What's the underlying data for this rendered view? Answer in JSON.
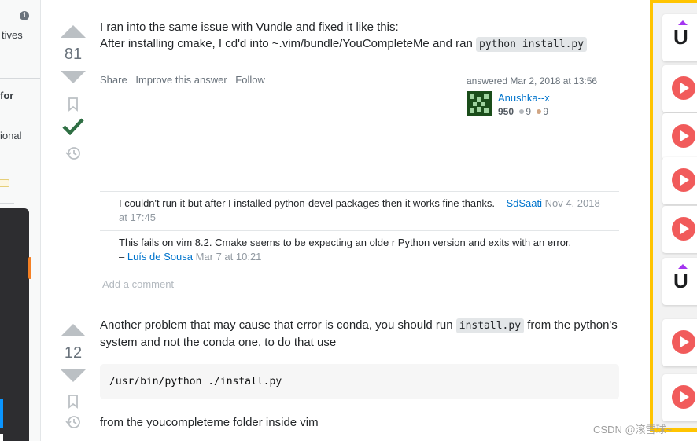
{
  "left_sidebar": {
    "fragments": [
      "tives",
      "for",
      "ional"
    ]
  },
  "answers": [
    {
      "votes": "81",
      "accepted": true,
      "body_line1": "I ran into the same issue with Vundle and fixed it like this:",
      "body_line2_prefix": "After installing cmake, I cd'd into ~.vim/bundle/YouCompleteMe and ran ",
      "body_line2_code": "python install.py",
      "menu": [
        "Share",
        "Improve this answer",
        "Follow"
      ],
      "user": {
        "action_time": "answered Mar 2, 2018 at 13:56",
        "name": "Anushka--x",
        "reputation": "950",
        "silver": "9",
        "bronze": "9"
      },
      "comments": [
        {
          "text": "I couldn't run it but after I installed python-devel packages then it works fine thanks. – ",
          "user": "SdSaati",
          "date": " Nov 4, 2018 at 17:45"
        },
        {
          "text": "This fails on vim 8.2. Cmake seems to be expecting an olde r Python version and exits with an error.",
          "prefix": "– ",
          "user": "Luís de Sousa",
          "date": " Mar 7 at 10:21"
        }
      ],
      "add_comment": "Add a comment"
    },
    {
      "votes": "12",
      "body_prefix": "Another problem that may cause that error is conda, you should run ",
      "body_code": "install.py",
      "body_suffix": " from the python's system and not the conda one, to do that use",
      "code_block": "/usr/bin/python ./install.py",
      "body_after": "from the youcompleteme folder inside vim"
    }
  ],
  "ads": [
    "udemy-icon",
    "play-icon",
    "play-icon",
    "play-icon",
    "play-icon",
    "udemy-icon",
    "play-icon",
    "play-icon"
  ],
  "watermark": "CSDN @滚雪球~",
  "colors": {
    "accent": "#0074cc",
    "accepted": "#2f6f44",
    "ad_border": "#ffc400"
  }
}
